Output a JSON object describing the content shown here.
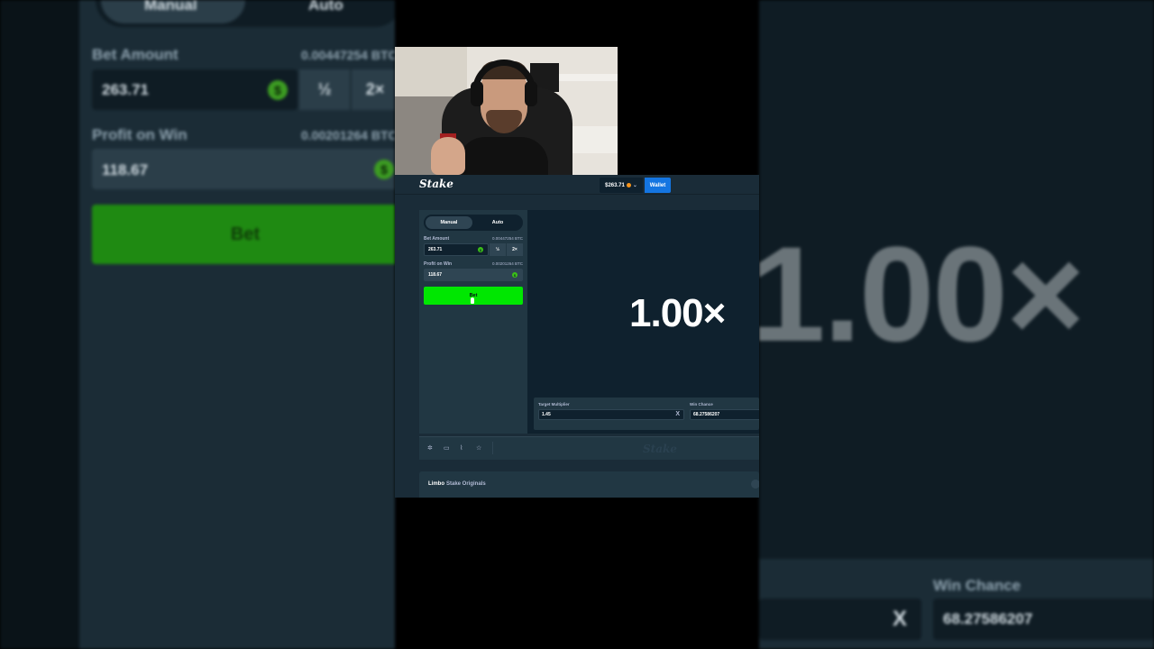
{
  "header": {
    "logo": "Stake",
    "balance": "$263.71",
    "balance_chevron": "⌄",
    "wallet_label": "Wallet"
  },
  "sidebar": {
    "tabs": [
      {
        "label": "Manual",
        "active": true
      },
      {
        "label": "Auto",
        "active": false
      }
    ],
    "bet_amount_label": "Bet Amount",
    "bet_amount_btc": "0.00447254 BTC",
    "bet_amount_value": "263.71",
    "half_label": "½",
    "double_label": "2×",
    "profit_label": "Profit on Win",
    "profit_btc": "0.00201264 BTC",
    "profit_value": "118.67",
    "coin_symbol": "$",
    "bet_button": "Bet"
  },
  "game": {
    "multiplier_display": "1.00×",
    "target_multiplier_label": "Target Multiplier",
    "target_multiplier_value": "1.45",
    "clear_symbol": "X",
    "win_chance_label": "Win Chance",
    "win_chance_value": "68.27586207"
  },
  "footer": {
    "icons": [
      "settings-icon",
      "screen-icon",
      "stats-icon",
      "star-icon"
    ],
    "watermark": "Stake"
  },
  "info_bar": {
    "game_name": "Limbo",
    "provider": "Stake Originals"
  },
  "colors": {
    "bg_dark": "#0f212e",
    "panel": "#213743",
    "bet_green": "#00e701",
    "wallet_blue": "#1475e1",
    "btc_orange": "#f7931a"
  }
}
